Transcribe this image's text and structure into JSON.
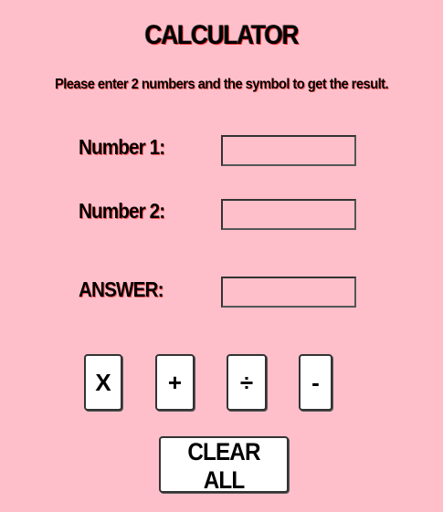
{
  "header": {
    "title": "CALCULATOR",
    "instructions": "Please enter 2 numbers and the symbol to get the result."
  },
  "form": {
    "number1_label": "Number 1:",
    "number1_value": "",
    "number2_label": "Number 2:",
    "number2_value": "",
    "answer_label": "ANSWER:",
    "answer_value": ""
  },
  "operators": {
    "multiply": "X",
    "add": "+",
    "divide": "÷",
    "subtract": "-"
  },
  "actions": {
    "clear_all": "CLEAR ALL"
  },
  "colors": {
    "background": "#ffbfca",
    "button": "#ffffff",
    "text_shadow": "#ff3b3b"
  }
}
